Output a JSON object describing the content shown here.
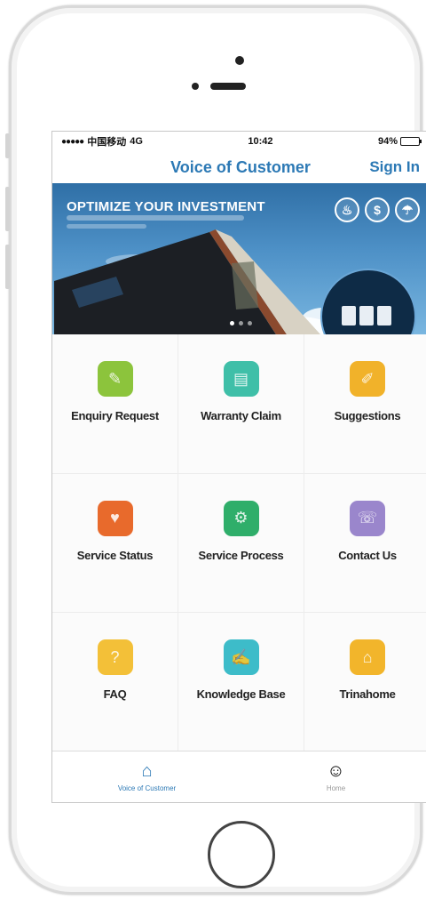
{
  "status_bar": {
    "carrier": "中国移动",
    "network": "4G",
    "time": "10:42",
    "battery": "94%"
  },
  "nav": {
    "title": "Voice of Customer",
    "sign_in": "Sign In"
  },
  "banner": {
    "title": "OPTIMIZE YOUR INVESTMENT",
    "badges": [
      "♨",
      "$",
      "☂"
    ]
  },
  "grid": {
    "items": [
      {
        "label": "Enquiry Request",
        "icon": "enquiry-icon",
        "color": "#8cc43c",
        "glyph": "✎"
      },
      {
        "label": "Warranty Claim",
        "icon": "warranty-icon",
        "color": "#3fbfa8",
        "glyph": "▤"
      },
      {
        "label": "Suggestions",
        "icon": "suggestions-icon",
        "color": "#f1b22a",
        "glyph": "✐"
      },
      {
        "label": "Service Status",
        "icon": "service-status-icon",
        "color": "#e86a2c",
        "glyph": "♥"
      },
      {
        "label": "Service Process",
        "icon": "service-process-icon",
        "color": "#2fae6a",
        "glyph": "⚙"
      },
      {
        "label": "Contact Us",
        "icon": "contact-icon",
        "color": "#9a86cc",
        "glyph": "☏"
      },
      {
        "label": "FAQ",
        "icon": "faq-icon",
        "color": "#f3c038",
        "glyph": "?"
      },
      {
        "label": "Knowledge Base",
        "icon": "knowledge-icon",
        "color": "#3dbcc9",
        "glyph": "✍"
      },
      {
        "label": "Trinahome",
        "icon": "trinahome-icon",
        "color": "#f2b52b",
        "glyph": "⌂"
      }
    ]
  },
  "tabs": [
    {
      "label": "Voice of Customer",
      "icon": "home-icon",
      "glyph": "⌂",
      "active": true
    },
    {
      "label": "Home",
      "icon": "user-icon",
      "glyph": "☺",
      "active": false
    }
  ]
}
